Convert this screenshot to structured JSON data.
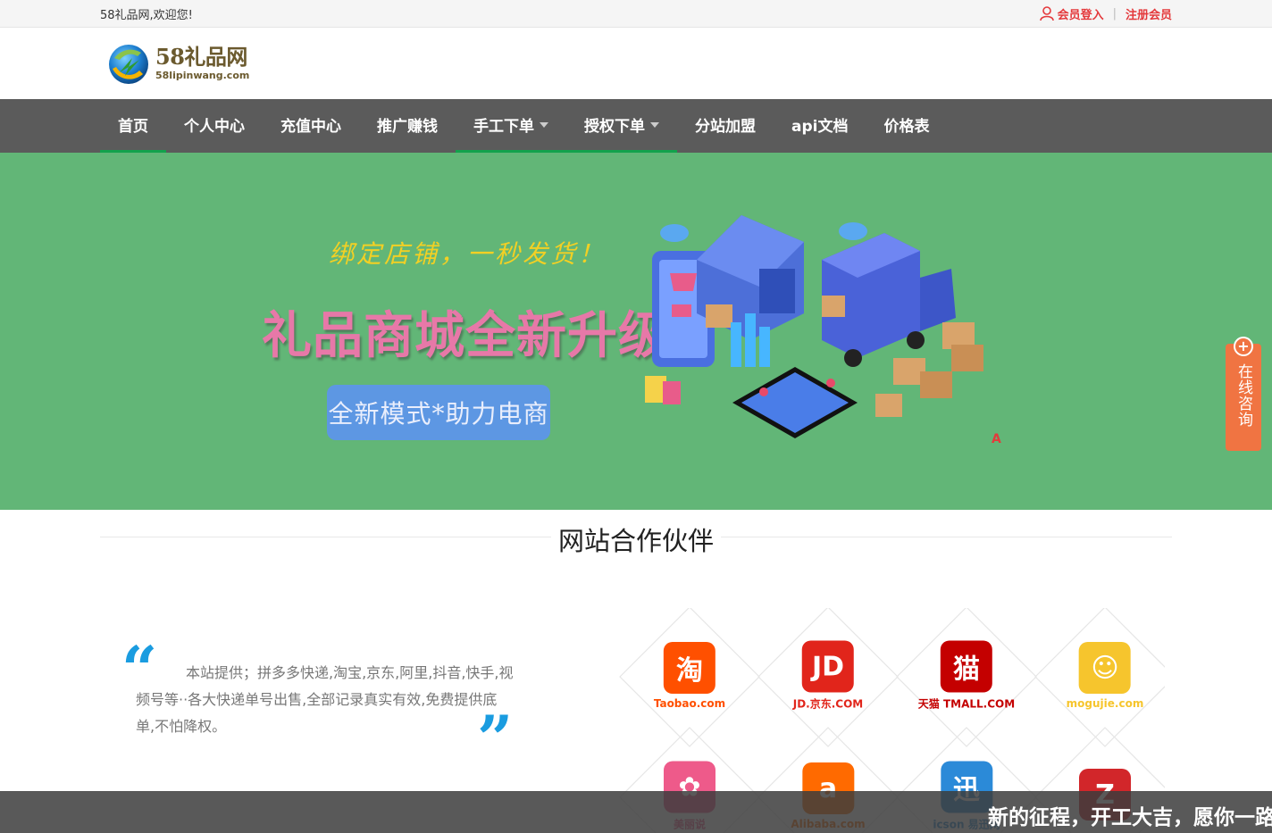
{
  "topbar": {
    "welcome": "58礼品网,欢迎您!",
    "login": "会员登入",
    "separator": "|",
    "register": "注册会员"
  },
  "logo": {
    "main": "58礼品网",
    "sub": "58lipinwang.com"
  },
  "nav": {
    "items": [
      {
        "label": "首页",
        "active": true
      },
      {
        "label": "个人中心"
      },
      {
        "label": "充值中心"
      },
      {
        "label": "推广赚钱"
      },
      {
        "label": "手工下单",
        "dropdown": true,
        "active": true
      },
      {
        "label": "授权下单",
        "dropdown": true,
        "active": true
      },
      {
        "label": "分站加盟"
      },
      {
        "label": "api文档"
      },
      {
        "label": "价格表"
      }
    ]
  },
  "banner": {
    "line1": "绑定店铺，一秒发货！",
    "line2": "礼品商城全新升级",
    "button": "全新模式*助力电商",
    "mark": "A",
    "bg_color": "#62b677"
  },
  "consult": {
    "label": "在线咨询",
    "plus": "+"
  },
  "partners": {
    "title": "网站合作伙伴",
    "quote": "本站提供；拼多多快递,淘宝,京东,阿里,抖音,快手,视频号等··各大快递单号出售,全部记录真实有效,免费提供底单,不怕降权。",
    "logos": [
      {
        "name": "Taobao.com",
        "glyph": "淘",
        "color": "#ff5000"
      },
      {
        "name": "JD.京东.COM",
        "glyph": "JD",
        "color": "#e1251b"
      },
      {
        "name": "天猫 TMALL.COM",
        "glyph": "猫",
        "color": "#c40000"
      },
      {
        "name": "mogujie.com",
        "glyph": "☺",
        "color": "#f6c52d"
      },
      {
        "name": "美丽说",
        "glyph": "✿",
        "color": "#ee5a8a"
      },
      {
        "name": "Alibaba.com",
        "glyph": "a",
        "color": "#ff6a00"
      },
      {
        "name": "icson 易迅网",
        "glyph": "迅",
        "color": "#2b8ad8"
      },
      {
        "name": "",
        "glyph": "Z",
        "color": "#d2262a"
      }
    ]
  },
  "ticker": {
    "text": "新的征程，开工大吉，愿你一路"
  }
}
